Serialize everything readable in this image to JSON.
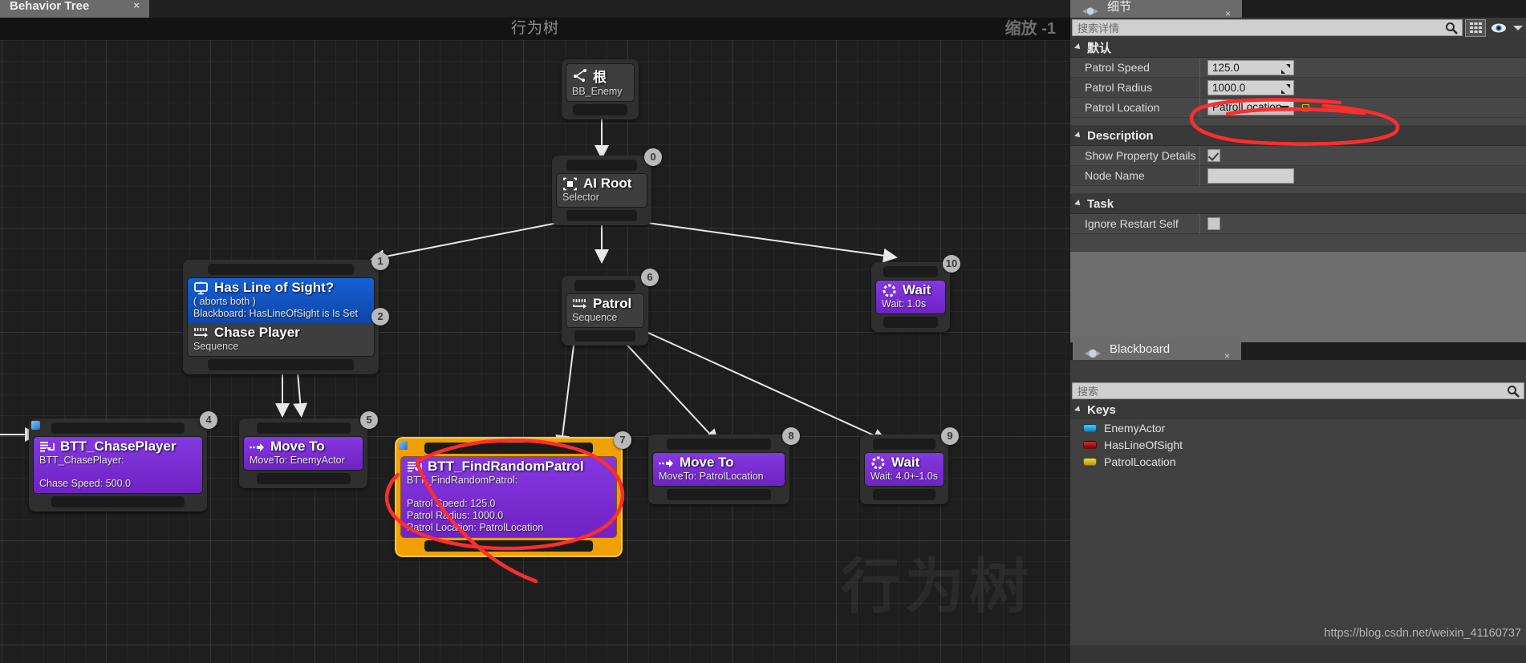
{
  "editor": {
    "tab_label": "Behavior Tree",
    "close_label": "×",
    "graph_title": "行为树",
    "zoom_label": "缩放 -1",
    "watermark": "行为树"
  },
  "nodes": {
    "root": {
      "title": "根",
      "icon": "root-icon",
      "subtitle": "BB_Enemy"
    },
    "ai_root": {
      "index": "0",
      "title": "AI Root",
      "icon": "selector-icon",
      "subtitle": "Selector"
    },
    "has_line_of_sight": {
      "index": "1",
      "decorator_index": "2",
      "title": "Has Line of Sight?",
      "icon": "decorator-icon",
      "line1": "( aborts both )",
      "line2": "Blackboard: HasLineOfSight is Is Set",
      "child_title": "Chase Player",
      "child_icon": "sequence-icon",
      "child_subtitle": "Sequence"
    },
    "btt_chase_player": {
      "index": "4",
      "title": "BTT_ChasePlayer",
      "icon": "task-icon",
      "line1": "BTT_ChasePlayer:",
      "line2": "",
      "line3": "Chase Speed: 500.0"
    },
    "move_to_enemy": {
      "index": "5",
      "title": "Move To",
      "icon": "moveto-icon",
      "subtitle": "MoveTo: EnemyActor"
    },
    "patrol": {
      "index": "6",
      "title": "Patrol",
      "icon": "sequence-icon",
      "subtitle": "Sequence"
    },
    "btt_find_random_patrol": {
      "index": "7",
      "title": "BTT_FindRandomPatrol",
      "icon": "task-icon",
      "line1": "BTT_FindRandomPatrol:",
      "line2": "",
      "line3": "Patrol Speed: 125.0",
      "line4": "Patrol Radius: 1000.0",
      "line5": "Patrol Location: PatrolLocation"
    },
    "move_to_patrol": {
      "index": "8",
      "title": "Move To",
      "icon": "moveto-icon",
      "subtitle": "MoveTo: PatrolLocation"
    },
    "wait_patrol": {
      "index": "9",
      "title": "Wait",
      "icon": "wait-icon",
      "subtitle": "Wait: 4.0+-1.0s"
    },
    "wait_idle": {
      "index": "10",
      "title": "Wait",
      "icon": "wait-icon",
      "subtitle": "Wait: 1.0s"
    }
  },
  "details": {
    "tab_label": "细节",
    "tab_icon": "details-icon",
    "close_label": "×",
    "search_placeholder": "搜索详情",
    "search_value": "",
    "tool_grid": "grid-view-icon",
    "tool_eye": "eye-icon",
    "tool_chevron": "chevron-down-icon",
    "categories": [
      {
        "name": "默认",
        "rows": [
          {
            "label": "Patrol Speed",
            "value": "125.0",
            "type": "number"
          },
          {
            "label": "Patrol Radius",
            "value": "1000.0",
            "type": "number"
          },
          {
            "label": "Patrol Location",
            "value": "PatrolLocation",
            "type": "combo"
          }
        ]
      },
      {
        "name": "Description",
        "rows": [
          {
            "label": "Show Property Details",
            "value": "checked",
            "type": "checkbox"
          },
          {
            "label": "Node Name",
            "value": "",
            "type": "text"
          }
        ]
      },
      {
        "name": "Task",
        "rows": [
          {
            "label": "Ignore Restart Self",
            "value": "unchecked",
            "type": "checkbox"
          }
        ]
      }
    ]
  },
  "blackboard": {
    "tab_label": "Blackboard",
    "tab_icon": "blackboard-icon",
    "close_label": "×",
    "search_placeholder": "搜索",
    "search_value": "",
    "keys_header": "Keys",
    "keys": [
      {
        "name": "EnemyActor",
        "color": "#1ea8e0"
      },
      {
        "name": "HasLineOfSight",
        "color": "#b00d0d"
      },
      {
        "name": "PatrolLocation",
        "color": "#d6c21a"
      }
    ]
  },
  "watermark_url": "https://blog.csdn.net/weixin_41160737",
  "colors": {
    "selection": "#f0a000",
    "annotation": "#ff2d2d",
    "task_node": "#7b2fd0",
    "decorator_node": "#1256c0"
  }
}
